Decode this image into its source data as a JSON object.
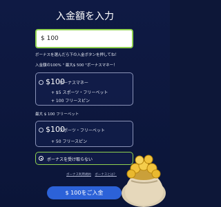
{
  "title": "入金額を入力",
  "amount_input": {
    "value": "$ 100"
  },
  "hint": "ボーナスを選んだら下の入金ボタンを押してね！",
  "deposit_line": "入金額の100% \" 最大$ 500 \"ボーナスマネー！",
  "bonus_option_1": {
    "amount": "$100",
    "type": "ボーナスマネー",
    "line1": "+ $5 スポーツ・フリーベット",
    "line2": "+ 100 フリースピン"
  },
  "max_line": "最大 $ 100 フリーベット",
  "bonus_option_2": {
    "amount": "$100",
    "type": "スポーツ・フリーベット",
    "line1": "+ 50 フリースピン"
  },
  "decline_option": {
    "label": "ボーナスを受け取らない"
  },
  "links": {
    "terms": "ボーナス利用規約",
    "what_is_bonus": "ボーナスとは？"
  },
  "submit_button": {
    "label": "$ 100をご入金"
  },
  "colors": {
    "accent_green": "#8fd14f",
    "button_blue": "#2c62d8",
    "background": "#0d1738"
  }
}
